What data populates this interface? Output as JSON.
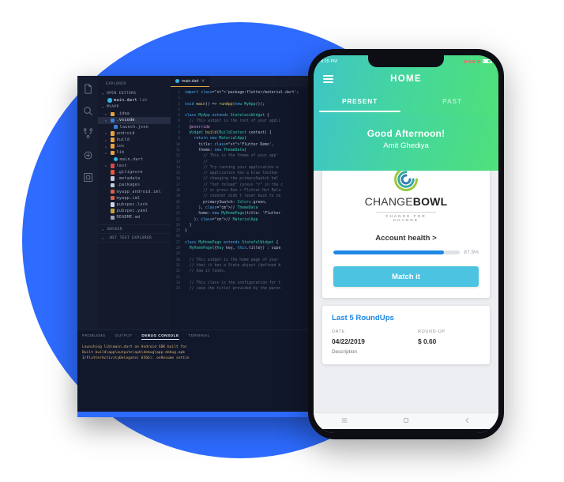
{
  "theme": {
    "blue_circle": "#2E6BFF",
    "vscode_bg": "#12182b",
    "phone_gradient_start": "#3ec6c6",
    "phone_gradient_end": "#4fe07a",
    "accent_blue": "#1e88e5",
    "button_cyan": "#4cc3e0",
    "tab_underline": "#e0a43c"
  },
  "vscode": {
    "activity_icons": [
      "files-icon",
      "search-icon",
      "source-control-icon",
      "debug-icon",
      "extensions-icon"
    ],
    "explorer_label": "EXPLORER",
    "sections": [
      {
        "label": "OPEN EDITORS"
      },
      {
        "label": "MYAPP"
      }
    ],
    "open_editors": [
      {
        "label": "main.dart",
        "suffix": "lib",
        "icon": "dart-file-icon"
      }
    ],
    "tree": [
      {
        "label": ".idea",
        "icon": "folder-icon",
        "indent": 1,
        "arrow": true,
        "selected": false
      },
      {
        "label": ".vscode",
        "icon": "folder-code-icon",
        "indent": 1,
        "arrow": true,
        "selected": true
      },
      {
        "label": "launch.json",
        "icon": "json-file-icon",
        "indent": 2,
        "arrow": false,
        "selected": false
      },
      {
        "label": "android",
        "icon": "folder-icon",
        "indent": 1,
        "arrow": true,
        "selected": false
      },
      {
        "label": "build",
        "icon": "folder-icon",
        "indent": 1,
        "arrow": true,
        "selected": false
      },
      {
        "label": "ios",
        "icon": "folder-icon",
        "indent": 1,
        "arrow": true,
        "selected": false
      },
      {
        "label": "lib",
        "icon": "folder-icon",
        "indent": 1,
        "arrow": true,
        "selected": false
      },
      {
        "label": "main.dart",
        "icon": "dart-file-icon",
        "indent": 2,
        "arrow": false,
        "selected": false
      },
      {
        "label": "test",
        "icon": "folder-test-icon",
        "indent": 1,
        "arrow": true,
        "selected": false
      },
      {
        "label": ".gitignore",
        "icon": "git-file-icon",
        "indent": 1,
        "arrow": false,
        "selected": false
      },
      {
        "label": ".metadata",
        "icon": "file-icon",
        "indent": 1,
        "arrow": false,
        "selected": false
      },
      {
        "label": ".packages",
        "icon": "file-icon",
        "indent": 1,
        "arrow": false,
        "selected": false
      },
      {
        "label": "myapp_android.iml",
        "icon": "xml-file-icon",
        "indent": 1,
        "arrow": false,
        "selected": false
      },
      {
        "label": "myapp.iml",
        "icon": "xml-file-icon",
        "indent": 1,
        "arrow": false,
        "selected": false
      },
      {
        "label": "pubspec.lock",
        "icon": "lock-file-icon",
        "indent": 1,
        "arrow": false,
        "selected": false
      },
      {
        "label": "pubspec.yaml",
        "icon": "yaml-file-icon",
        "indent": 1,
        "arrow": false,
        "selected": false
      },
      {
        "label": "README.md",
        "icon": "markdown-icon",
        "indent": 1,
        "arrow": false,
        "selected": false
      }
    ],
    "bottom_panels": [
      {
        "label": "DOCKER"
      },
      {
        "label": ".NET TEST EXPLORER"
      }
    ],
    "editor_tab": {
      "label": "main.dart",
      "close": "✕",
      "icon": "dart-file-icon"
    },
    "code_lines": [
      {
        "n": 1,
        "text": "import 'package:flutter/material.dart';"
      },
      {
        "n": 2,
        "text": ""
      },
      {
        "n": 3,
        "text": "void main() => runApp(new MyApp());"
      },
      {
        "n": 4,
        "text": ""
      },
      {
        "n": 5,
        "text": "class MyApp extends StatelessWidget {"
      },
      {
        "n": 6,
        "text": "  // This widget is the root of your appli"
      },
      {
        "n": 7,
        "text": "  @override"
      },
      {
        "n": 8,
        "text": "  Widget build(BuildContext context) {"
      },
      {
        "n": 9,
        "text": "    return new MaterialApp("
      },
      {
        "n": 10,
        "text": "      title: 'Flutter Demo',"
      },
      {
        "n": 11,
        "text": "      theme: new ThemeData("
      },
      {
        "n": 12,
        "text": "        // This is the theme of your app'"
      },
      {
        "n": 13,
        "text": "        //"
      },
      {
        "n": 14,
        "text": "        // Try running your application w"
      },
      {
        "n": 15,
        "text": "        // application has a blue toolbar"
      },
      {
        "n": 16,
        "text": "        // changing the primarySwatch bel"
      },
      {
        "n": 17,
        "text": "        // \"hot reload\" (press \"r\" in the c"
      },
      {
        "n": 18,
        "text": "        // or press Run > Flutter Hot Relo"
      },
      {
        "n": 19,
        "text": "        // counter didn't reset back to ze"
      },
      {
        "n": 20,
        "text": "        primarySwatch: Colors.green,"
      },
      {
        "n": 21,
        "text": "      ), // ThemeData"
      },
      {
        "n": 22,
        "text": "      home: new MyHomePage(title: 'Flutter"
      },
      {
        "n": 23,
        "text": "    ); // MaterialApp"
      },
      {
        "n": 24,
        "text": "  }"
      },
      {
        "n": 25,
        "text": "}"
      },
      {
        "n": 26,
        "text": ""
      },
      {
        "n": 27,
        "text": "class MyHomePage extends StatefulWidget {"
      },
      {
        "n": 28,
        "text": "  MyHomePage({Key key, this.title}) : supe"
      },
      {
        "n": 29,
        "text": ""
      },
      {
        "n": 30,
        "text": "  // This widget is the home page of your"
      },
      {
        "n": 31,
        "text": "  // that it has a State object (defined b"
      },
      {
        "n": 32,
        "text": "  // how it looks."
      },
      {
        "n": 33,
        "text": ""
      },
      {
        "n": 34,
        "text": "  // This class is the configuration for t"
      },
      {
        "n": 35,
        "text": "  // case the title) provided by the paren"
      }
    ],
    "console_tabs": [
      {
        "label": "PROBLEMS",
        "active": false
      },
      {
        "label": "OUTPUT",
        "active": false
      },
      {
        "label": "DEBUG CONSOLE",
        "active": true
      },
      {
        "label": "TERMINAL",
        "active": false
      }
    ],
    "console_output": [
      "Launching lib\\main.dart on Android SDK built for",
      "Built build\\app\\outputs\\apk\\debug\\app-debug.apk",
      "I/FlutterActivityDelegate( 6566): onResume settin"
    ]
  },
  "phone": {
    "status": {
      "time": "8:15 PM",
      "signal_icon": "signal-rings-icon",
      "battery_icon": "battery-icon"
    },
    "appbar": {
      "menu_icon": "hamburger-menu-icon",
      "title": "HOME"
    },
    "tabs": [
      {
        "label": "PRESENT",
        "active": true
      },
      {
        "label": "PAST",
        "active": false
      }
    ],
    "greeting": {
      "line1": "Good Afternoon!",
      "line2": "Amit Ghediya"
    },
    "brand": {
      "logo_icon": "changebowl-swirl-logo",
      "name_light": "CHANGE",
      "name_bold": "BOWL",
      "tagline": "CHANGE FOR CHANGE"
    },
    "health": {
      "label": "Account health >",
      "percent_label": "87.5%",
      "percent_value": 87.5
    },
    "match_button": "Match it",
    "roundups": {
      "title": "Last 5 RoundUps",
      "columns": [
        "DATE",
        "ROUND-UP"
      ],
      "rows": [
        {
          "date": "04/22/2019",
          "amount": "$ 0.60"
        }
      ],
      "description_label": "Description"
    },
    "navbar": [
      {
        "icon": "recents-icon"
      },
      {
        "icon": "home-square-icon"
      },
      {
        "icon": "back-chevron-icon"
      }
    ]
  }
}
